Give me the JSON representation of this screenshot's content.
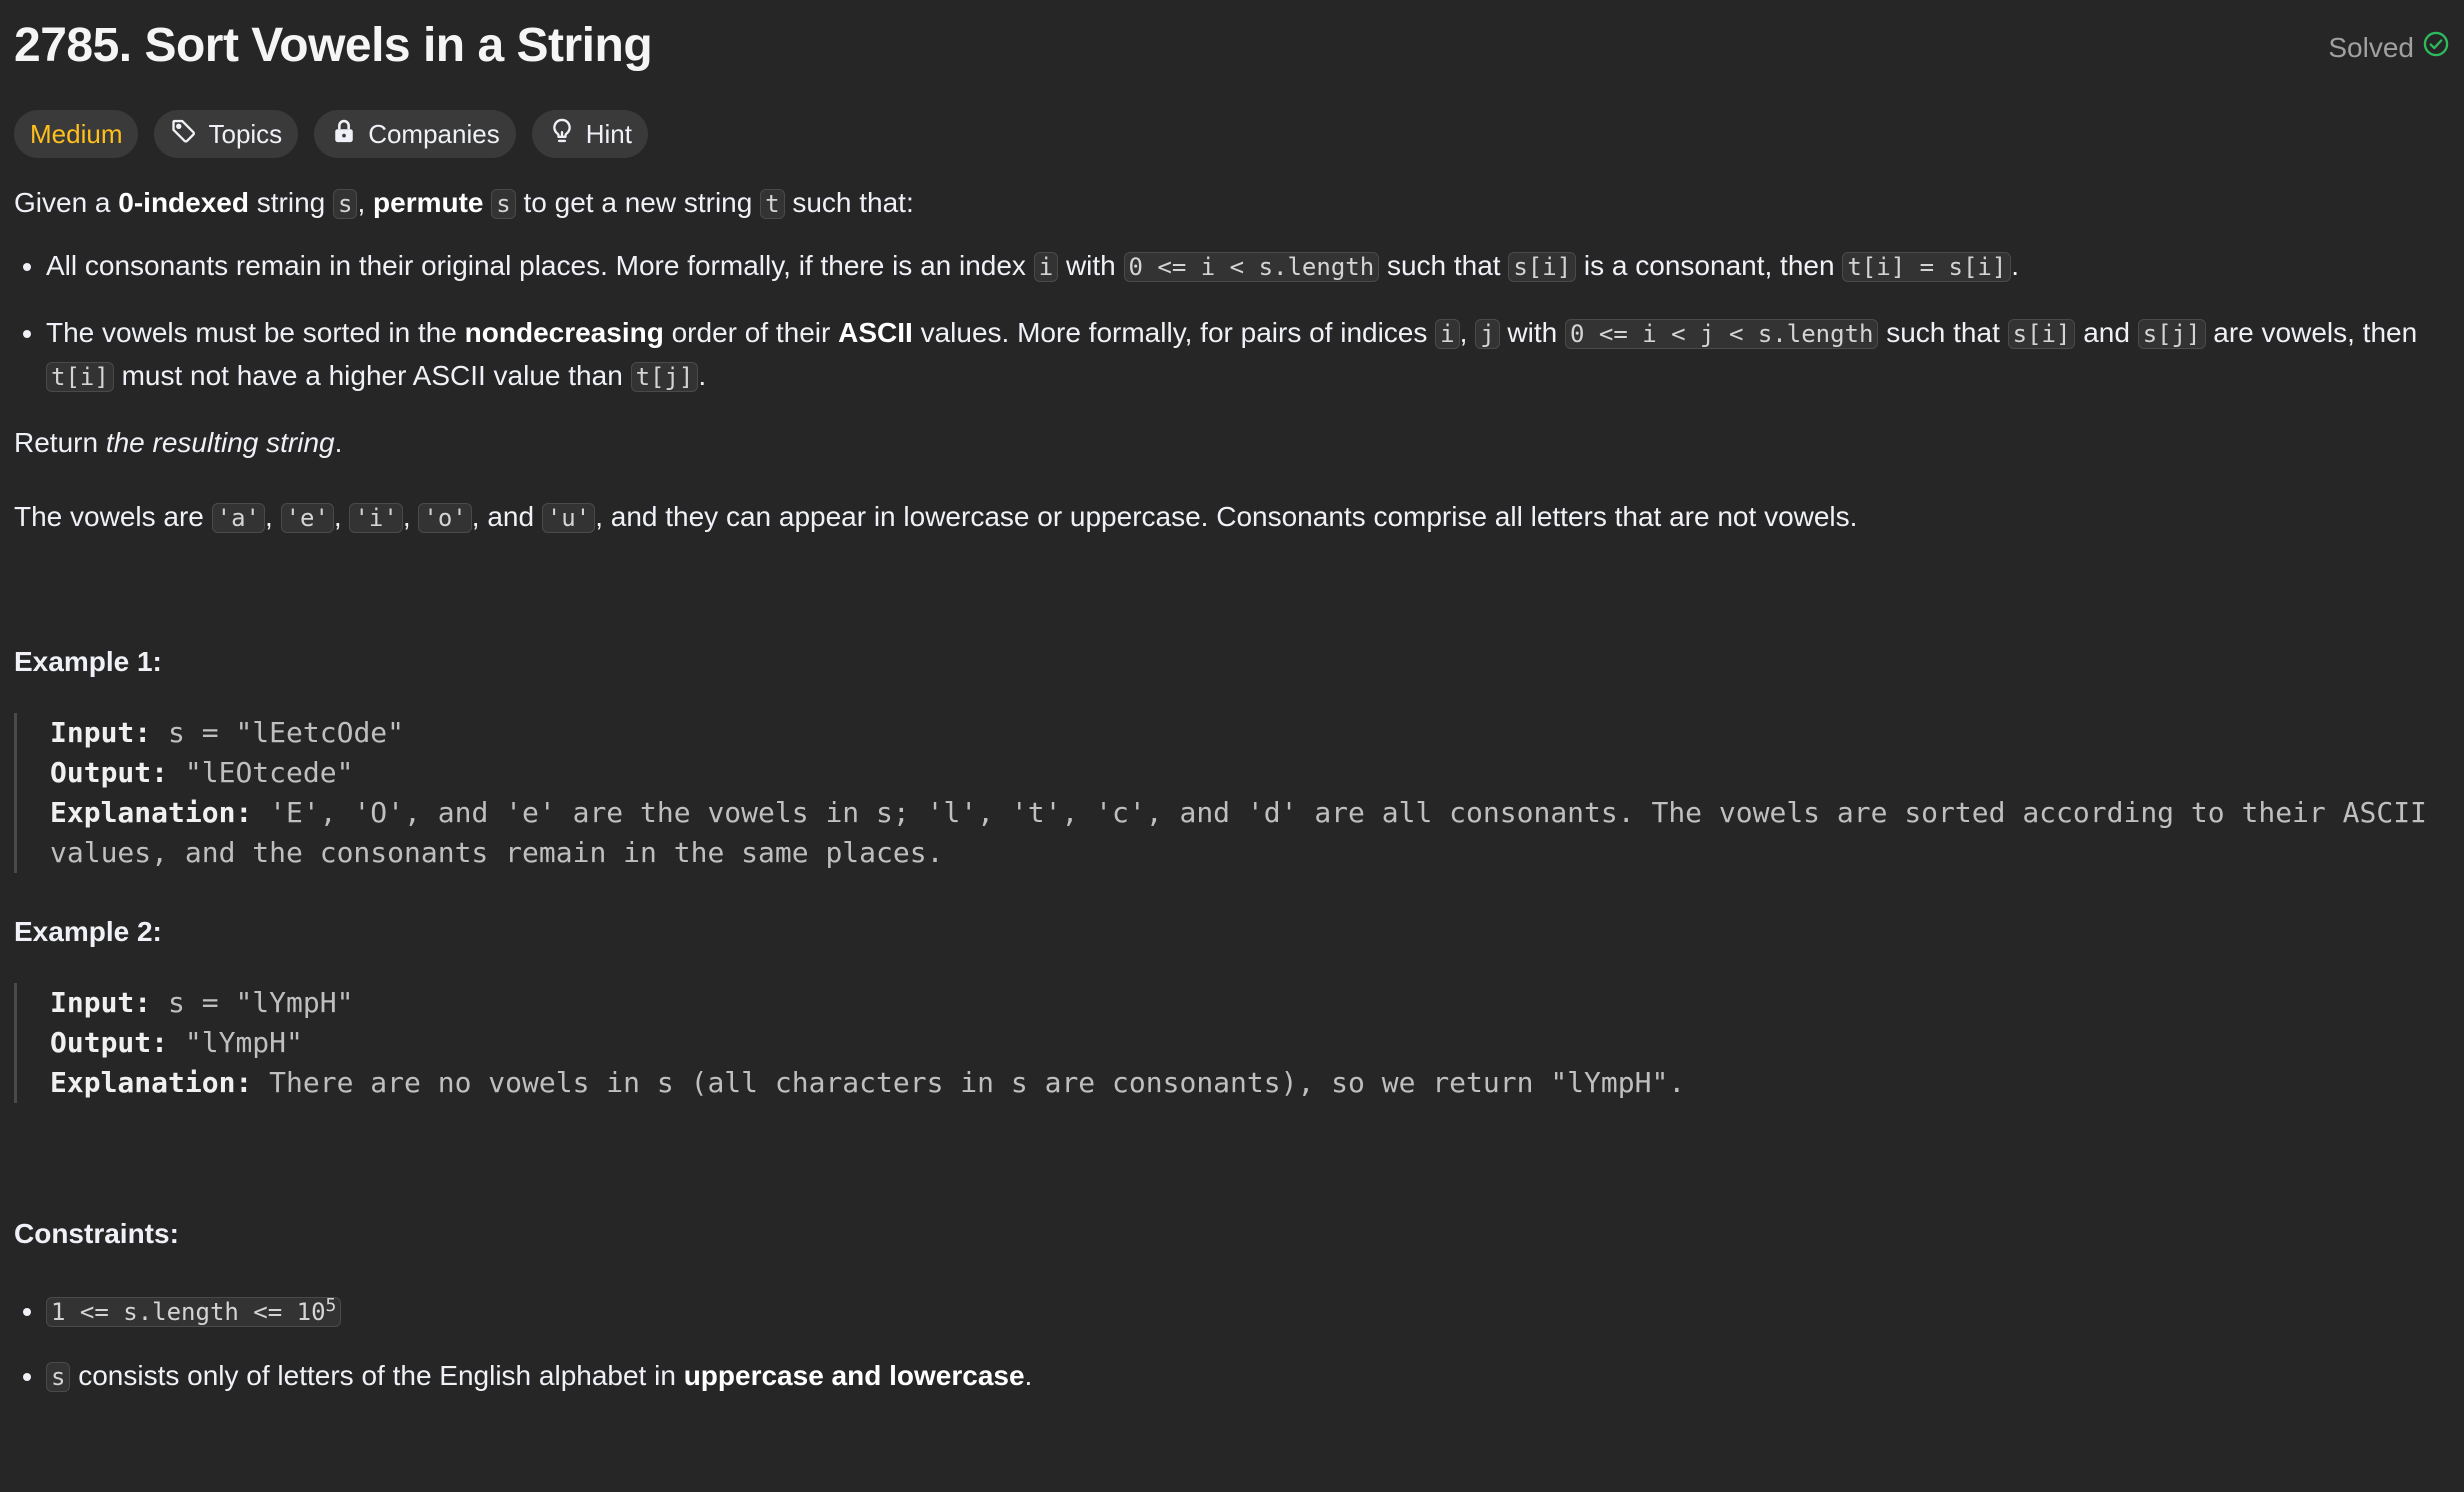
{
  "problem": {
    "title": "2785. Sort Vowels in a String",
    "status": "Solved"
  },
  "tags": {
    "difficulty": "Medium",
    "topics": "Topics",
    "companies": "Companies",
    "hint": "Hint"
  },
  "description": {
    "intro": {
      "t1": "Given a ",
      "b1": "0-indexed",
      "t2": " string ",
      "c1": "s",
      "t3": ", ",
      "b2": "permute",
      "t4": " ",
      "c2": "s",
      "t5": " to get a new string ",
      "c3": "t",
      "t6": " such that:"
    },
    "rule1": {
      "t1": "All consonants remain in their original places. More formally, if there is an index ",
      "c1": "i",
      "t2": " with ",
      "c2": "0 <= i < s.length",
      "t3": " such that ",
      "c3": "s[i]",
      "t4": " is a consonant, then ",
      "c4": "t[i] = s[i]",
      "t5": "."
    },
    "rule2": {
      "t1": "The vowels must be sorted in the ",
      "b1": "nondecreasing",
      "t2": " order of their ",
      "b2": "ASCII",
      "t3": " values. More formally, for pairs of indices ",
      "c1": "i",
      "t4": ", ",
      "c2": "j",
      "t5": " with ",
      "c3": "0 <= i < j < s.length",
      "t6": " such that ",
      "c4": "s[i]",
      "t7": " and ",
      "c5": "s[j]",
      "t8": " are vowels, then ",
      "c6": "t[i]",
      "t9": " must not have a higher ASCII value than ",
      "c7": "t[j]",
      "t10": "."
    },
    "return_line": {
      "t1": "Return ",
      "i1": "the resulting string",
      "t2": "."
    },
    "vowels_line": {
      "t1": "The vowels are ",
      "c1": "'a'",
      "t2": ", ",
      "c2": "'e'",
      "t3": ", ",
      "c3": "'i'",
      "t4": ", ",
      "c4": "'o'",
      "t5": ", and ",
      "c5": "'u'",
      "t6": ", and they can appear in lowercase or uppercase. Consonants comprise all letters that are not vowels."
    }
  },
  "examples": [
    {
      "title": "Example 1:",
      "input_label": "Input:",
      "input": " s = \"lEetcOde\"",
      "output_label": "Output:",
      "output": " \"lEOtcede\"",
      "explanation_label": "Explanation:",
      "explanation_line1": " 'E', 'O', and 'e' are the vowels in s; 'l', 't', 'c', and 'd' are all consonants. The vowels are sorted according to their ASCII",
      "explanation_line2": "values, and the consonants remain in the same places."
    },
    {
      "title": "Example 2:",
      "input_label": "Input:",
      "input": " s = \"lYmpH\"",
      "output_label": "Output:",
      "output": " \"lYmpH\"",
      "explanation_label": "Explanation:",
      "explanation_line1": " There are no vowels in s (all characters in s are consonants), so we return \"lYmpH\"."
    }
  ],
  "constraints": {
    "title": "Constraints:",
    "c1": {
      "code": "1 <= s.length <= 10",
      "sup": "5"
    },
    "c2": {
      "code": "s",
      "t1": " consists only of letters of the English alphabet in ",
      "b1": "uppercase and lowercase",
      "t2": "."
    }
  },
  "colors": {
    "background": "#262626",
    "text": "#eff1f6",
    "medium": "#ffc01e",
    "solved_check": "#2cbb5d",
    "tag_bg": "#3a3a3a"
  },
  "icons": {
    "solved": "check-circle-icon",
    "topics": "tag-icon",
    "companies": "lock-icon",
    "hint": "lightbulb-icon"
  }
}
